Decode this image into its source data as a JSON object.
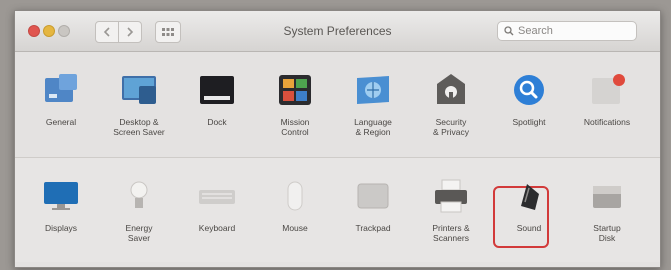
{
  "window": {
    "title": "System Preferences"
  },
  "search": {
    "placeholder": "Search"
  },
  "row1": [
    {
      "label": "General",
      "icon": "general-icon"
    },
    {
      "label": "Desktop &\nScreen Saver",
      "icon": "desktop-screensaver-icon"
    },
    {
      "label": "Dock",
      "icon": "dock-icon"
    },
    {
      "label": "Mission\nControl",
      "icon": "mission-control-icon"
    },
    {
      "label": "Language\n& Region",
      "icon": "language-region-icon"
    },
    {
      "label": "Security\n& Privacy",
      "icon": "security-privacy-icon"
    },
    {
      "label": "Spotlight",
      "icon": "spotlight-icon"
    },
    {
      "label": "Notifications",
      "icon": "notifications-icon"
    }
  ],
  "row2": [
    {
      "label": "Displays",
      "icon": "displays-icon"
    },
    {
      "label": "Energy\nSaver",
      "icon": "energy-saver-icon"
    },
    {
      "label": "Keyboard",
      "icon": "keyboard-icon"
    },
    {
      "label": "Mouse",
      "icon": "mouse-icon"
    },
    {
      "label": "Trackpad",
      "icon": "trackpad-icon"
    },
    {
      "label": "Printers &\nScanners",
      "icon": "printers-scanners-icon"
    },
    {
      "label": "Sound",
      "icon": "sound-icon",
      "selected": true
    },
    {
      "label": "Startup\nDisk",
      "icon": "startup-disk-icon"
    }
  ],
  "colors": {
    "selection_outline": "#d23a3a",
    "close": "#e0554f",
    "minimize": "#e5b640"
  }
}
